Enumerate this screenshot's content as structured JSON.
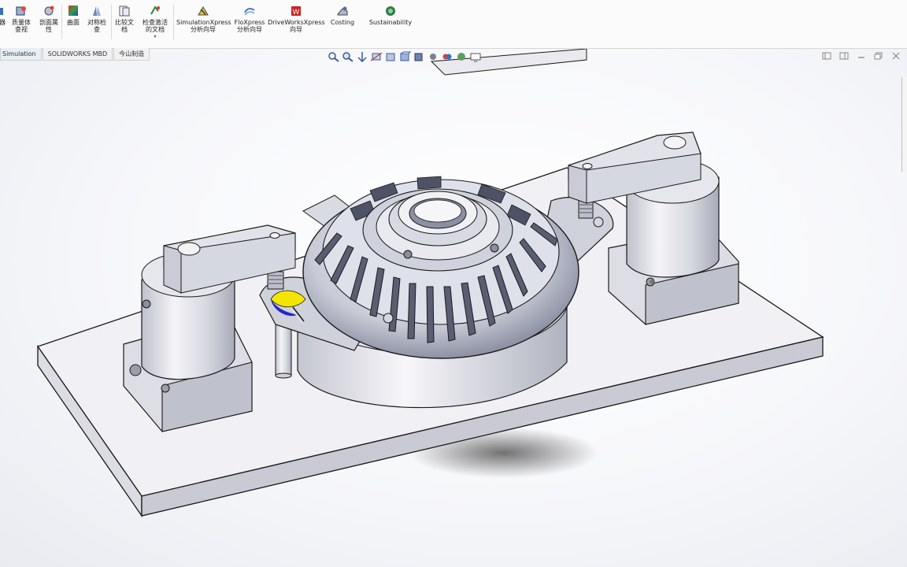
{
  "ribbon": {
    "items": [
      {
        "id": "cut",
        "label": "器",
        "icon": "edge-icon"
      },
      {
        "id": "mass",
        "label": "质量体\n查视",
        "icon": "mass-properties-icon"
      },
      {
        "id": "section",
        "label": "剖面属\n性",
        "icon": "section-props-icon"
      },
      {
        "id": "surface",
        "label": "曲面",
        "icon": "surface-icon"
      },
      {
        "id": "compare",
        "label": "对称检\n查",
        "icon": "symmetry-icon"
      },
      {
        "id": "doc",
        "label": "比较文\n档",
        "icon": "compare-doc-icon"
      },
      {
        "id": "check",
        "label": "检查激活\n的文档",
        "icon": "check-doc-icon"
      },
      {
        "id": "simxpress",
        "label": "SimulationXpress\n分析向导",
        "icon": "simulationxpress-icon"
      },
      {
        "id": "floxpress",
        "label": "FloXpress\n分析向导",
        "icon": "floxpress-icon"
      },
      {
        "id": "driveworks",
        "label": "DriveWorksXpress\n向导",
        "icon": "driveworks-icon"
      },
      {
        "id": "costing",
        "label": "Costing",
        "icon": "costing-icon"
      },
      {
        "id": "sustain",
        "label": "Sustainability",
        "icon": "sustainability-icon"
      }
    ]
  },
  "tabs": [
    "Simulation",
    "SOLIDWORKS MBD",
    "今山制造"
  ],
  "colors": {
    "plate": "#e8e8ee",
    "metal": "#d5d7df",
    "edge": "#1a1a1a",
    "highlight_yellow": "#f2e600",
    "highlight_blue": "#2326c8"
  }
}
